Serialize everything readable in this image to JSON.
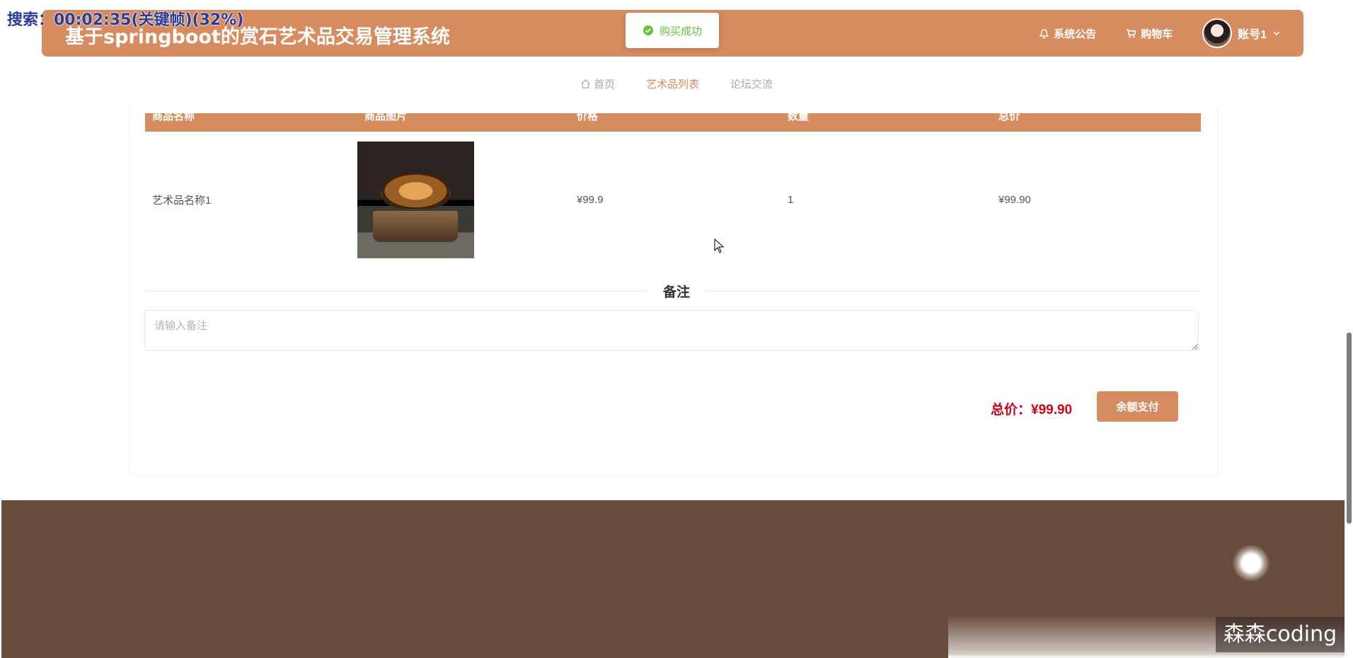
{
  "overlay": {
    "search_text": "搜索：00:02:35(关键帧)(32%)"
  },
  "header": {
    "title": "基于springboot的赏石艺术品交易管理系统",
    "notice_label": "系统公告",
    "cart_label": "购物车",
    "account_label": "账号1"
  },
  "toast": {
    "message": "购买成功"
  },
  "nav": {
    "items": [
      {
        "label": "首页"
      },
      {
        "label": "艺术品列表"
      },
      {
        "label": "论坛交流"
      }
    ]
  },
  "table": {
    "headers": [
      "商品名称",
      "商品图片",
      "价格",
      "数量",
      "总价"
    ],
    "rows": [
      {
        "name": "艺术品名称1",
        "price": "¥99.9",
        "quantity": "1",
        "total": "¥99.90"
      }
    ]
  },
  "remark": {
    "title": "备注",
    "placeholder": "请输入备注"
  },
  "summary": {
    "total_text": "总价：¥99.90",
    "pay_label": "余额支付"
  },
  "watermark": {
    "text": "森森coding"
  },
  "colors": {
    "accent": "#d78c5f",
    "footer": "#684d3c",
    "price_red": "#d0021b",
    "success": "#67c23a"
  }
}
